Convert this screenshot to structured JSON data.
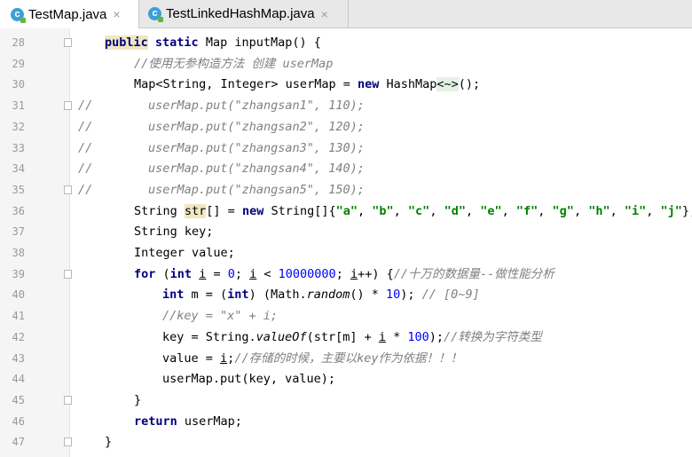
{
  "tabs": [
    {
      "label": "TestMap.java",
      "close": "×",
      "icon": "java-class-icon"
    },
    {
      "label": "TestLinkedHashMap.java",
      "close": "×",
      "icon": "java-class-icon"
    }
  ],
  "gutter": {
    "line_numbers": [
      "28",
      "29",
      "30",
      "31",
      "32",
      "33",
      "34",
      "35",
      "36",
      "37",
      "38",
      "39",
      "40",
      "41",
      "42",
      "43",
      "44",
      "45",
      "46",
      "47"
    ]
  },
  "code": {
    "l28": {
      "kw1": "public",
      "kw2": "static",
      "rest": " Map inputMap() {"
    },
    "l29": {
      "comment": "//使用无参构造方法 创建 userMap"
    },
    "l30": {
      "a": "Map<String, Integer> userMap = ",
      "kw": "new",
      "b": " HashMap",
      "c": "<~>",
      "d": "();"
    },
    "l31": {
      "prefix": "//",
      "text": "userMap.put(\"zhangsan1\", 110);"
    },
    "l32": {
      "prefix": "//",
      "text": "userMap.put(\"zhangsan2\", 120);"
    },
    "l33": {
      "prefix": "//",
      "text": "userMap.put(\"zhangsan3\", 130);"
    },
    "l34": {
      "prefix": "//",
      "text": "userMap.put(\"zhangsan4\", 140);"
    },
    "l35": {
      "prefix": "//",
      "text": "userMap.put(\"zhangsan5\", 150);"
    },
    "l36": {
      "a": "String ",
      "var": "str",
      "b": "[] = ",
      "kw": "new",
      "c": " String[]{",
      "strs": [
        "\"a\"",
        "\"b\"",
        "\"c\"",
        "\"d\"",
        "\"e\"",
        "\"f\"",
        "\"g\"",
        "\"h\"",
        "\"i\"",
        "\"j\""
      ],
      "sep": ", ",
      "end": "};"
    },
    "l37": {
      "text": "String key;"
    },
    "l38": {
      "text": "Integer value;"
    },
    "l39": {
      "kw": "for",
      "a": " (",
      "kw2": "int",
      "b": " ",
      "v": "i",
      "c": " = ",
      "n1": "0",
      "d": "; ",
      "v2": "i",
      "e": " < ",
      "n2": "10000000",
      "f": "; ",
      "v3": "i",
      "g": "++) {",
      "comment": "//十万的数据量--做性能分析"
    },
    "l40": {
      "kw": "int",
      "a": " m = (",
      "kw2": "int",
      "b": ") (Math.",
      "m": "random",
      "c": "() * ",
      "n": "10",
      "d": "); ",
      "comment": "// [0~9]"
    },
    "l41": {
      "comment": "//key = \"x\" + i;"
    },
    "l42": {
      "a": "key = String.",
      "m": "valueOf",
      "b": "(str[m] + ",
      "v": "i",
      "c": " * ",
      "n": "100",
      "d": ");",
      "comment": "//转换为字符类型"
    },
    "l43": {
      "a": "value = ",
      "v": "i",
      "b": ";",
      "comment": "//存储的时候，主要以key作为依据！！！"
    },
    "l44": {
      "text": "userMap.put(key, value);"
    },
    "l45": {
      "text": "}"
    },
    "l46": {
      "kw": "return",
      "rest": " userMap;"
    },
    "l47": {
      "text": "}"
    }
  }
}
